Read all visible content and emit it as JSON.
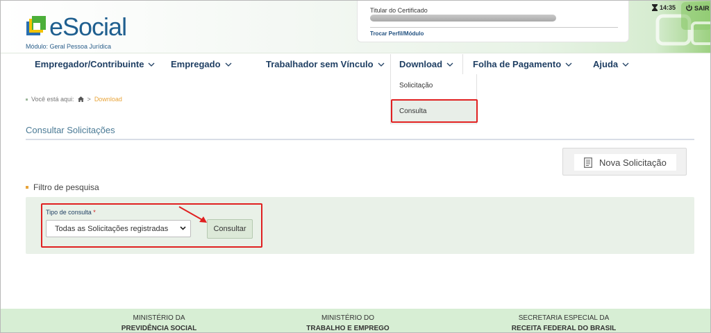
{
  "header": {
    "logo_text": "eSocial",
    "module": "Módulo: Geral Pessoa Jurídica",
    "cert_label": "Titular do Certificado",
    "change_profile": "Trocar Perfil/Módulo",
    "time": "14:35",
    "logout": "SAIR"
  },
  "nav": {
    "items": [
      {
        "label": "Empregador/Contribuinte"
      },
      {
        "label": "Empregado"
      },
      {
        "label": "Trabalhador sem Vínculo"
      },
      {
        "label": "Download"
      },
      {
        "label": "Folha de Pagamento"
      },
      {
        "label": "Ajuda"
      }
    ],
    "dropdown": [
      "Solicitação",
      "Consulta"
    ]
  },
  "breadcrumb": {
    "prefix": "Você está aqui:",
    "separator": ">",
    "current": "Download"
  },
  "page": {
    "title": "Consultar Solicitações",
    "new_request": "Nova Solicitação",
    "filter_title": "Filtro de pesquisa",
    "tipo_label": "Tipo de consulta",
    "required_mark": "*",
    "tipo_value": "Todas as Solicitações registradas",
    "consultar": "Consultar"
  },
  "footer": [
    {
      "line1": "MINISTÉRIO DA",
      "line2": "PREVIDÊNCIA SOCIAL"
    },
    {
      "line1": "MINISTÉRIO DO",
      "line2": "TRABALHO E EMPREGO"
    },
    {
      "line1": "SECRETARIA ESPECIAL DA",
      "line2": "RECEITA FEDERAL DO BRASIL"
    }
  ],
  "colors": {
    "accent_red": "#e02020",
    "nav_text": "#1f3f63",
    "footer_bg": "#d7eed4",
    "breadcrumb_current": "#e8a43a"
  }
}
